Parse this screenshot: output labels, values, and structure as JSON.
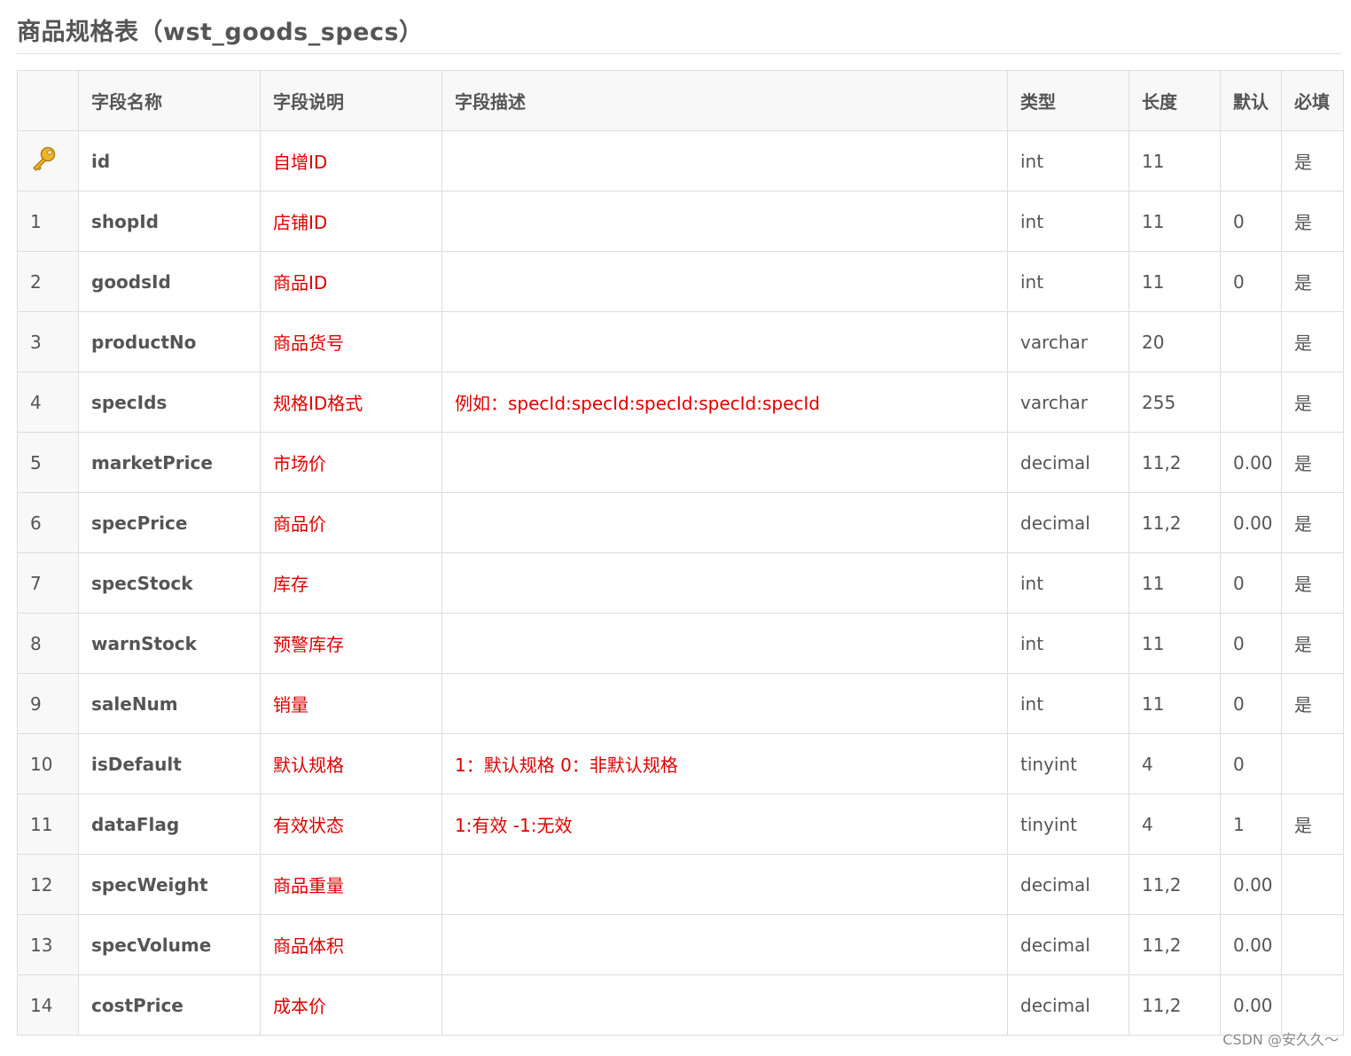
{
  "page": {
    "title": "商品规格表（wst_goods_specs）"
  },
  "table": {
    "headers": [
      "",
      "字段名称",
      "字段说明",
      "字段描述",
      "类型",
      "长度",
      "默认",
      "必填"
    ],
    "rows": [
      {
        "idx": "",
        "name": "id",
        "label": "自增ID",
        "desc": "",
        "type": "int",
        "length": "11",
        "default": "",
        "required": "是",
        "primary_key": true
      },
      {
        "idx": "1",
        "name": "shopId",
        "label": "店铺ID",
        "desc": "",
        "type": "int",
        "length": "11",
        "default": "0",
        "required": "是"
      },
      {
        "idx": "2",
        "name": "goodsId",
        "label": "商品ID",
        "desc": "",
        "type": "int",
        "length": "11",
        "default": "0",
        "required": "是"
      },
      {
        "idx": "3",
        "name": "productNo",
        "label": "商品货号",
        "desc": "",
        "type": "varchar",
        "length": "20",
        "default": "",
        "required": "是"
      },
      {
        "idx": "4",
        "name": "specIds",
        "label": "规格ID格式",
        "desc": "例如：specId:specId:specId:specId:specId",
        "type": "varchar",
        "length": "255",
        "default": "",
        "required": "是"
      },
      {
        "idx": "5",
        "name": "marketPrice",
        "label": "市场价",
        "desc": "",
        "type": "decimal",
        "length": "11,2",
        "default": "0.00",
        "required": "是"
      },
      {
        "idx": "6",
        "name": "specPrice",
        "label": "商品价",
        "desc": "",
        "type": "decimal",
        "length": "11,2",
        "default": "0.00",
        "required": "是"
      },
      {
        "idx": "7",
        "name": "specStock",
        "label": "库存",
        "desc": "",
        "type": "int",
        "length": "11",
        "default": "0",
        "required": "是"
      },
      {
        "idx": "8",
        "name": "warnStock",
        "label": "预警库存",
        "desc": "",
        "type": "int",
        "length": "11",
        "default": "0",
        "required": "是"
      },
      {
        "idx": "9",
        "name": "saleNum",
        "label": "销量",
        "desc": "",
        "type": "int",
        "length": "11",
        "default": "0",
        "required": "是"
      },
      {
        "idx": "10",
        "name": "isDefault",
        "label": "默认规格",
        "desc": "1：默认规格 0：非默认规格",
        "type": "tinyint",
        "length": "4",
        "default": "0",
        "required": ""
      },
      {
        "idx": "11",
        "name": "dataFlag",
        "label": "有效状态",
        "desc": "1:有效 -1:无效",
        "type": "tinyint",
        "length": "4",
        "default": "1",
        "required": "是"
      },
      {
        "idx": "12",
        "name": "specWeight",
        "label": "商品重量",
        "desc": "",
        "type": "decimal",
        "length": "11,2",
        "default": "0.00",
        "required": ""
      },
      {
        "idx": "13",
        "name": "specVolume",
        "label": "商品体积",
        "desc": "",
        "type": "decimal",
        "length": "11,2",
        "default": "0.00",
        "required": ""
      },
      {
        "idx": "14",
        "name": "costPrice",
        "label": "成本价",
        "desc": "",
        "type": "decimal",
        "length": "11,2",
        "default": "0.00",
        "required": ""
      }
    ]
  },
  "watermark": "CSDN @安久久～",
  "icons": {
    "primary_key": "key-icon"
  },
  "colors": {
    "label_text": "#e00000",
    "body_text": "#555555",
    "header_bg": "#f8f8f8",
    "border": "#dddddd",
    "key_icon": "#f0b429"
  }
}
